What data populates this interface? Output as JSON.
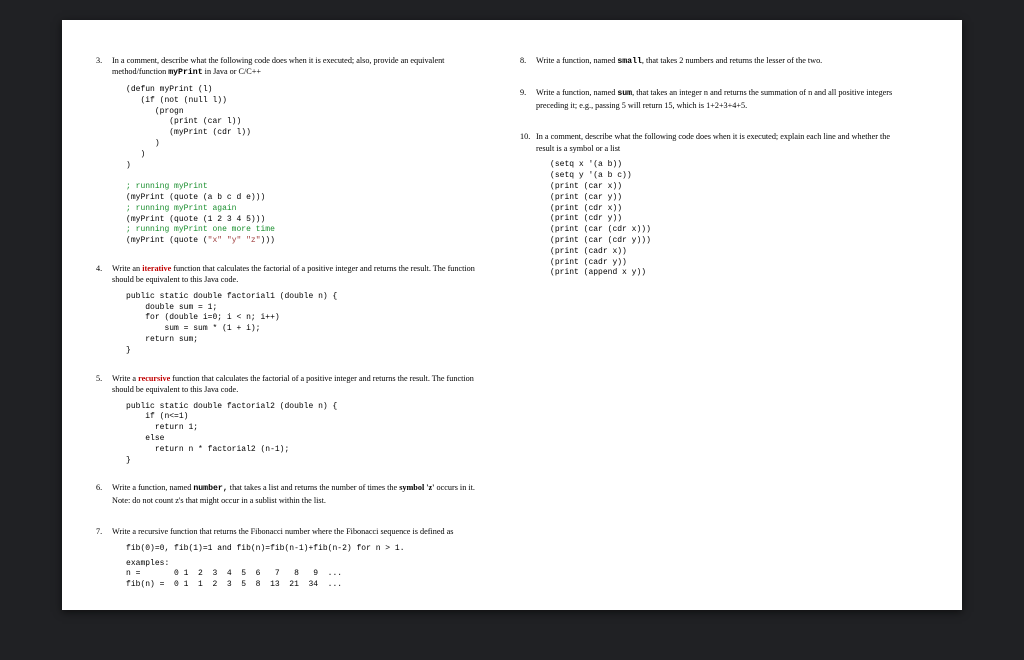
{
  "q3": {
    "num": "3.",
    "prompt_a": "In a comment, describe what the following code does when it is executed; also, provide an equivalent method/function ",
    "prompt_b": "myPrint",
    "prompt_c": " in Java or C/C++",
    "code_l1": "(defun myPrint (l)",
    "code_l2": "   (if (not (null l))",
    "code_l3": "      (progn",
    "code_l4": "         (print (car l))",
    "code_l5": "         (myPrint (cdr l))",
    "code_l6": "      )",
    "code_l7": "   )",
    "code_l8": ")",
    "code_c1": "; running myPrint",
    "code_l9": "(myPrint (quote (a b c d e)))",
    "code_c2": "; running myPrint again",
    "code_l10": "(myPrint (quote (1 2 3 4 5)))",
    "code_c3": "; running myPrint one more time",
    "code_l11a": "(myPrint (quote (",
    "code_s1": "\"x\"",
    "code_s2": "\"y\"",
    "code_s3": "\"z\"",
    "code_l11b": ")))"
  },
  "q4": {
    "num": "4.",
    "prompt_a": "Write an ",
    "prompt_hl": "iterative",
    "prompt_b": " function that calculates the factorial of a positive integer and returns the result. The function should be equivalent to this Java code.",
    "code": "public static double factorial1 (double n) {\n    double sum = 1;\n    for (double i=0; i < n; i++)\n        sum = sum * (1 + i);\n    return sum;\n}"
  },
  "q5": {
    "num": "5.",
    "prompt_a": "Write a ",
    "prompt_hl": "recursive",
    "prompt_b": " function that calculates the factorial of a positive integer and returns the result. The function should be equivalent to this Java code.",
    "code": "public static double factorial2 (double n) {\n    if (n<=1)\n      return 1;\n    else\n      return n * factorial2 (n-1);\n}"
  },
  "q6": {
    "num": "6.",
    "prompt_a": "Write a function, named ",
    "prompt_b": "number,",
    "prompt_c": " that takes a list and returns the number of times the ",
    "prompt_d": "symbol 'z'",
    "prompt_e": " occurs in it. Note: do not count z's that might occur in a sublist within the list."
  },
  "q7": {
    "num": "7.",
    "prompt": "Write a recursive function that returns the Fibonacci number where the Fibonacci sequence is defined as",
    "code_def": "fib(0)=0, fib(1)=1 and fib(n)=fib(n-1)+fib(n-2) for n > 1.",
    "code_ex": "examples:\nn =       0 1  2  3  4  5  6   7   8   9  ...\nfib(n) =  0 1  1  2  3  5  8  13  21  34  ..."
  },
  "q8": {
    "num": "8.",
    "prompt_a": "Write a function, named ",
    "prompt_b": "small",
    "prompt_c": ", that takes 2 numbers and returns the lesser of the two."
  },
  "q9": {
    "num": "9.",
    "prompt_a": "Write a function, named ",
    "prompt_b": "sum",
    "prompt_c": ", that takes an integer n and returns the summation of n and all positive integers preceding it; e.g., passing 5 will return 15, which is 1+2+3+4+5."
  },
  "q10": {
    "num": "10.",
    "prompt": "In a comment, describe what the following code does when it is executed; explain each line and whether the result is a symbol or a list",
    "code": "(setq x '(a b))\n(setq y '(a b c))\n(print (car x))\n(print (car y))\n(print (cdr x))\n(print (cdr y))\n(print (car (cdr x)))\n(print (car (cdr y)))\n(print (cadr x))\n(print (cadr y))\n(print (append x y))"
  }
}
